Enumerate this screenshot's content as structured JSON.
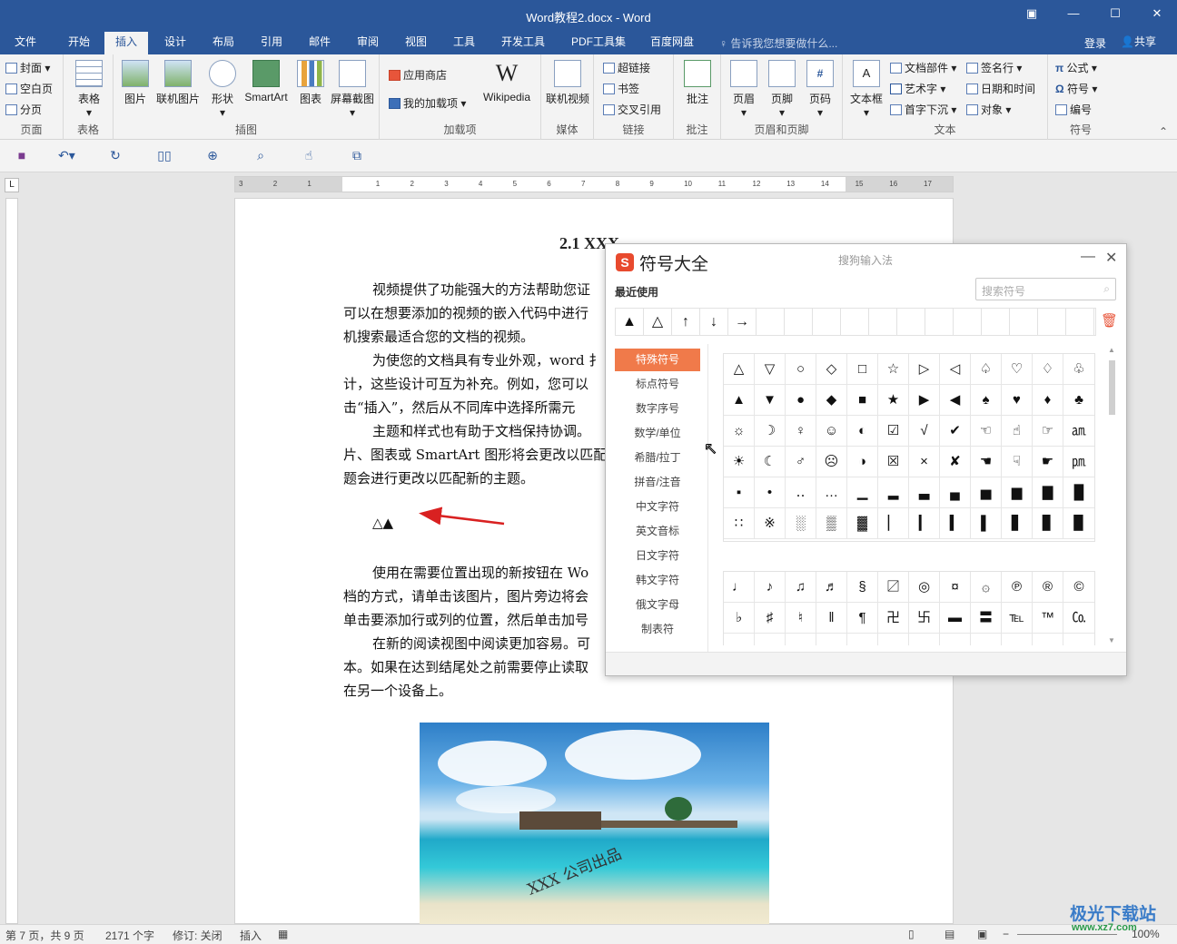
{
  "window": {
    "title": "Word教程2.docx - Word"
  },
  "tabs": [
    "文件",
    "开始",
    "插入",
    "设计",
    "布局",
    "引用",
    "邮件",
    "审阅",
    "视图",
    "工具",
    "开发工具",
    "PDF工具集",
    "百度网盘"
  ],
  "active_tab": "插入",
  "tell_me": "告诉我您想要做什么...",
  "login": "登录",
  "share": "共享",
  "ribbon": {
    "pages": {
      "label": "页面",
      "cover": "封面",
      "blank": "空白页",
      "break": "分页"
    },
    "tables": {
      "label": "表格",
      "table": "表格"
    },
    "illustrations": {
      "label": "插图",
      "picture": "图片",
      "online_picture": "联机图片",
      "shapes": "形状",
      "smartart": "SmartArt",
      "chart": "图表",
      "screenshot": "屏幕截图"
    },
    "addins": {
      "label": "加载项",
      "store": "应用商店",
      "my_addins": "我的加载项",
      "wikipedia": "Wikipedia"
    },
    "media": {
      "label": "媒体",
      "online_video": "联机视频"
    },
    "links": {
      "label": "链接",
      "hyperlink": "超链接",
      "bookmark": "书签",
      "crossref": "交叉引用"
    },
    "comments": {
      "label": "批注",
      "comment": "批注"
    },
    "header_footer": {
      "label": "页眉和页脚",
      "header": "页眉",
      "footer": "页脚",
      "page_number": "页码"
    },
    "text": {
      "label": "文本",
      "textbox": "文本框",
      "quick_parts": "文档部件",
      "wordart": "艺术字",
      "dropcap": "首字下沉",
      "signature": "签名行",
      "datetime": "日期和时间",
      "object": "对象"
    },
    "symbols": {
      "label": "符号",
      "equation": "公式",
      "symbol": "符号",
      "number": "编号"
    }
  },
  "ruler_numbers": [
    "3",
    "2",
    "1",
    "",
    "1",
    "2",
    "3",
    "4",
    "5",
    "6",
    "7",
    "8",
    "9",
    "10",
    "11",
    "12",
    "13",
    "14",
    "15",
    "16",
    "17"
  ],
  "document": {
    "heading": "2.1 XXX",
    "lines": [
      "视频提供了功能强大的方法帮助您证",
      "可以在想要添加的视频的嵌入代码中进行",
      "机搜索最适合您的文档的视频。",
      "为使您的文档具有专业外观，word 扌",
      "计，这些设计可互为补充。例如，您可以",
      "击“插入”，然后从不同库中选择所需元",
      "主题和样式也有助于文档保持协调。",
      "片、图表或 SmartArt 图形将会更改以匹配",
      "题会进行更改以匹配新的主题。",
      "△▲",
      "使用在需要位置出现的新按钮在 Wo",
      "档的方式，请单击该图片，图片旁边将会",
      "单击要添加行或列的位置，然后单击加号",
      "在新的阅读视图中阅读更加容易。可",
      "本。如果在达到结尾处之前需要停止读取",
      "在另一个设备上。"
    ],
    "image_caption": "XXX 公司出品"
  },
  "dialog": {
    "title": "符号大全",
    "subtitle": "搜狗输入法",
    "recent_label": "最近使用",
    "search_placeholder": "搜索符号",
    "recent": [
      "▲",
      "△",
      "↑",
      "↓",
      "→",
      "",
      "",
      "",
      "",
      "",
      "",
      "",
      "",
      "",
      "",
      "",
      ""
    ],
    "categories": [
      "特殊符号",
      "标点符号",
      "数字序号",
      "数学/单位",
      "希腊/拉丁",
      "拼音/注音",
      "中文字符",
      "英文音标",
      "日文字符",
      "韩文字符",
      "俄文字母",
      "制表符"
    ],
    "selected_category": "特殊符号",
    "grid1": [
      [
        "△",
        "▽",
        "○",
        "◇",
        "□",
        "☆",
        "▷",
        "◁",
        "♤",
        "♡",
        "♢",
        "♧"
      ],
      [
        "▲",
        "▼",
        "●",
        "◆",
        "■",
        "★",
        "▶",
        "◀",
        "♠",
        "♥",
        "♦",
        "♣"
      ],
      [
        "☼",
        "☽",
        "♀",
        "☺",
        "◐",
        "☑",
        "√",
        "✔",
        "☜",
        "☝",
        "☞",
        "㏂"
      ],
      [
        "☀",
        "☾",
        "♂",
        "☹",
        "◑",
        "☒",
        "×",
        "✘",
        "☚",
        "☟",
        "☛",
        "㏘"
      ],
      [
        "▪",
        "•",
        "‥",
        "…",
        "▁",
        "▂",
        "▃",
        "▄",
        "▅",
        "▆",
        "▇",
        "█"
      ],
      [
        "∷",
        "※",
        "░",
        "▒",
        "▓",
        "▏",
        "▎",
        "▍",
        "▌",
        "▋",
        "▊",
        "▉"
      ]
    ],
    "grid2": [
      [
        "♩",
        "♪",
        "♫",
        "♬",
        "§",
        "〼",
        "◎",
        "¤",
        "۞",
        "℗",
        "®",
        "©"
      ],
      [
        "♭",
        "♯",
        "♮",
        "‖",
        "¶",
        "卍",
        "卐",
        "▬",
        "〓",
        "℡",
        "™",
        "㏇"
      ],
      [
        "",
        "",
        "",
        "",
        "",
        "",
        "",
        "",
        "",
        "",
        "",
        ""
      ]
    ]
  },
  "status": {
    "page": "第 7 页，共 9 页",
    "words": "2171 个字",
    "track": "修订: 关闭",
    "mode": "插入",
    "zoom": "100%"
  },
  "watermark": {
    "name": "极光下载站",
    "url": "www.xz7.com"
  }
}
